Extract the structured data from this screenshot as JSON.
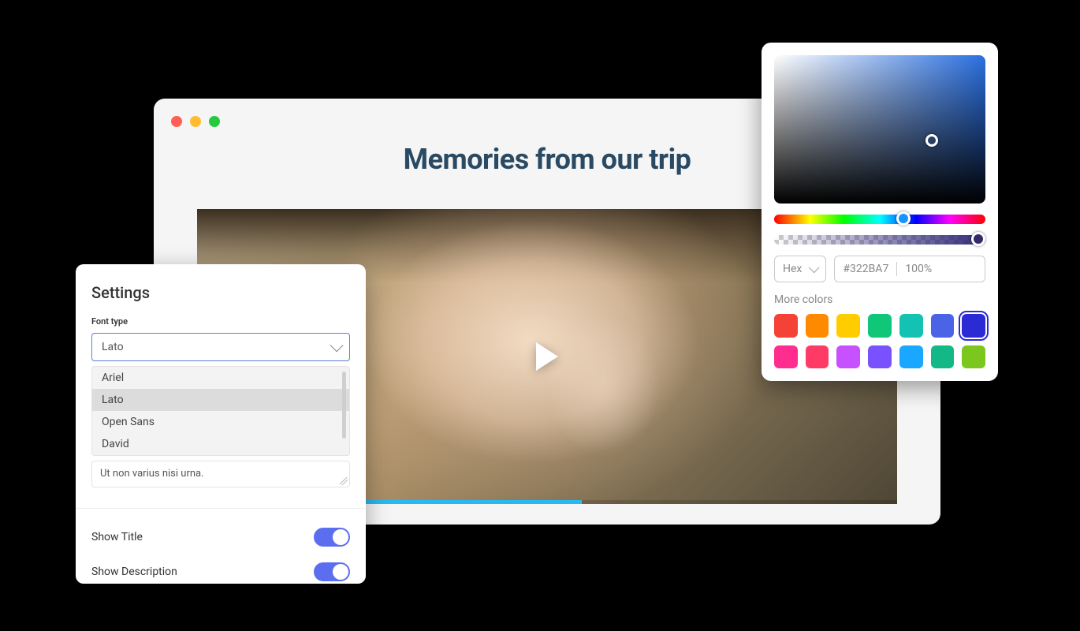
{
  "browser": {
    "title": "Memories from our trip"
  },
  "settings": {
    "heading": "Settings",
    "font_type_label": "Font type",
    "selected_font": "Lato",
    "font_options": [
      "Ariel",
      "Lato",
      "Open Sans",
      "David"
    ],
    "textarea_value": "Ut non varius nisi urna.",
    "toggles": {
      "show_title": {
        "label": "Show Title",
        "on": true
      },
      "show_description": {
        "label": "Show Description",
        "on": true
      }
    }
  },
  "picker": {
    "format_label": "Hex",
    "hex_value": "#322BA7",
    "opacity_label": "100%",
    "more_colors_label": "More colors",
    "swatches": [
      "#f44336",
      "#ff8a00",
      "#ffcc00",
      "#10c779",
      "#13c2b2",
      "#4a63e7",
      "#2b2bd6",
      "#ff2e8e",
      "#ff3b65",
      "#c851ff",
      "#7a51ff",
      "#1aa7ff",
      "#12b886",
      "#7bc71e"
    ],
    "selected_swatch_index": 6
  }
}
